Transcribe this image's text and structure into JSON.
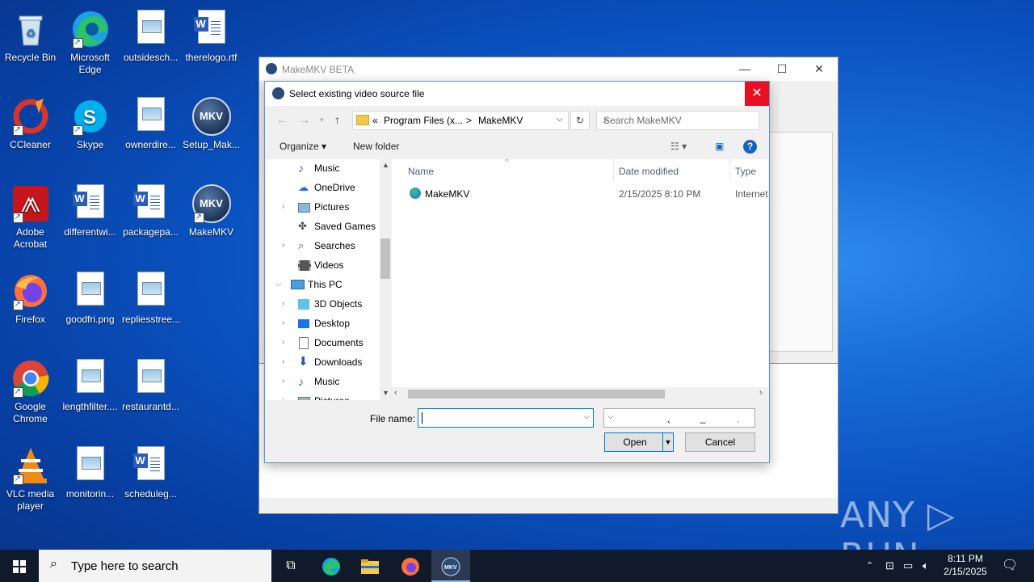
{
  "desktop": {
    "icons": [
      {
        "label": "Recycle Bin"
      },
      {
        "label": "Microsoft Edge"
      },
      {
        "label": "outsidesch..."
      },
      {
        "label": "therelogo.rtf"
      },
      {
        "label": "CCleaner"
      },
      {
        "label": "Skype"
      },
      {
        "label": "ownerdire..."
      },
      {
        "label": "Setup_Mak..."
      },
      {
        "label": "Adobe Acrobat"
      },
      {
        "label": "differentwi..."
      },
      {
        "label": "packagepa..."
      },
      {
        "label": "MakeMKV"
      },
      {
        "label": "Firefox"
      },
      {
        "label": "goodfri.png"
      },
      {
        "label": "repliesstree..."
      },
      {
        "label": "Google Chrome"
      },
      {
        "label": "lengthfilter...."
      },
      {
        "label": "restaurantd..."
      },
      {
        "label": "VLC media player"
      },
      {
        "label": "monitorin..."
      },
      {
        "label": "scheduleg..."
      }
    ]
  },
  "main_window": {
    "title": "MakeMKV BETA"
  },
  "dialog": {
    "title": "Select existing video source file",
    "close_glyph": "✕",
    "address": {
      "prefix": "«",
      "part1": "Program Files (x...",
      "sep": ">",
      "part2": "MakeMKV"
    },
    "search_placeholder": "Search MakeMKV",
    "organize_label": "Organize ▾",
    "new_folder_label": "New folder",
    "help_glyph": "?",
    "nav_items": [
      {
        "label": "Music"
      },
      {
        "label": "OneDrive"
      },
      {
        "label": "Pictures"
      },
      {
        "label": "Saved Games"
      },
      {
        "label": "Searches"
      },
      {
        "label": "Videos"
      },
      {
        "label": "This PC"
      },
      {
        "label": "3D Objects"
      },
      {
        "label": "Desktop"
      },
      {
        "label": "Documents"
      },
      {
        "label": "Downloads"
      },
      {
        "label": "Music"
      },
      {
        "label": "Pictures"
      }
    ],
    "columns": {
      "name": "Name",
      "date": "Date modified",
      "type": "Type"
    },
    "files": [
      {
        "name": "MakeMKV",
        "date": "2/15/2025 8:10 PM",
        "type": "Internet"
      }
    ],
    "file_name_label": "File name:",
    "file_name_value": "",
    "filter_label": "All video files (VIDEO_TS.IFO;DI:",
    "open_label": "Open",
    "cancel_label": "Cancel"
  },
  "taskbar": {
    "search_placeholder": "Type here to search",
    "time": "8:11 PM",
    "date": "2/15/2025"
  },
  "watermark": "ANY ▷ RUN"
}
